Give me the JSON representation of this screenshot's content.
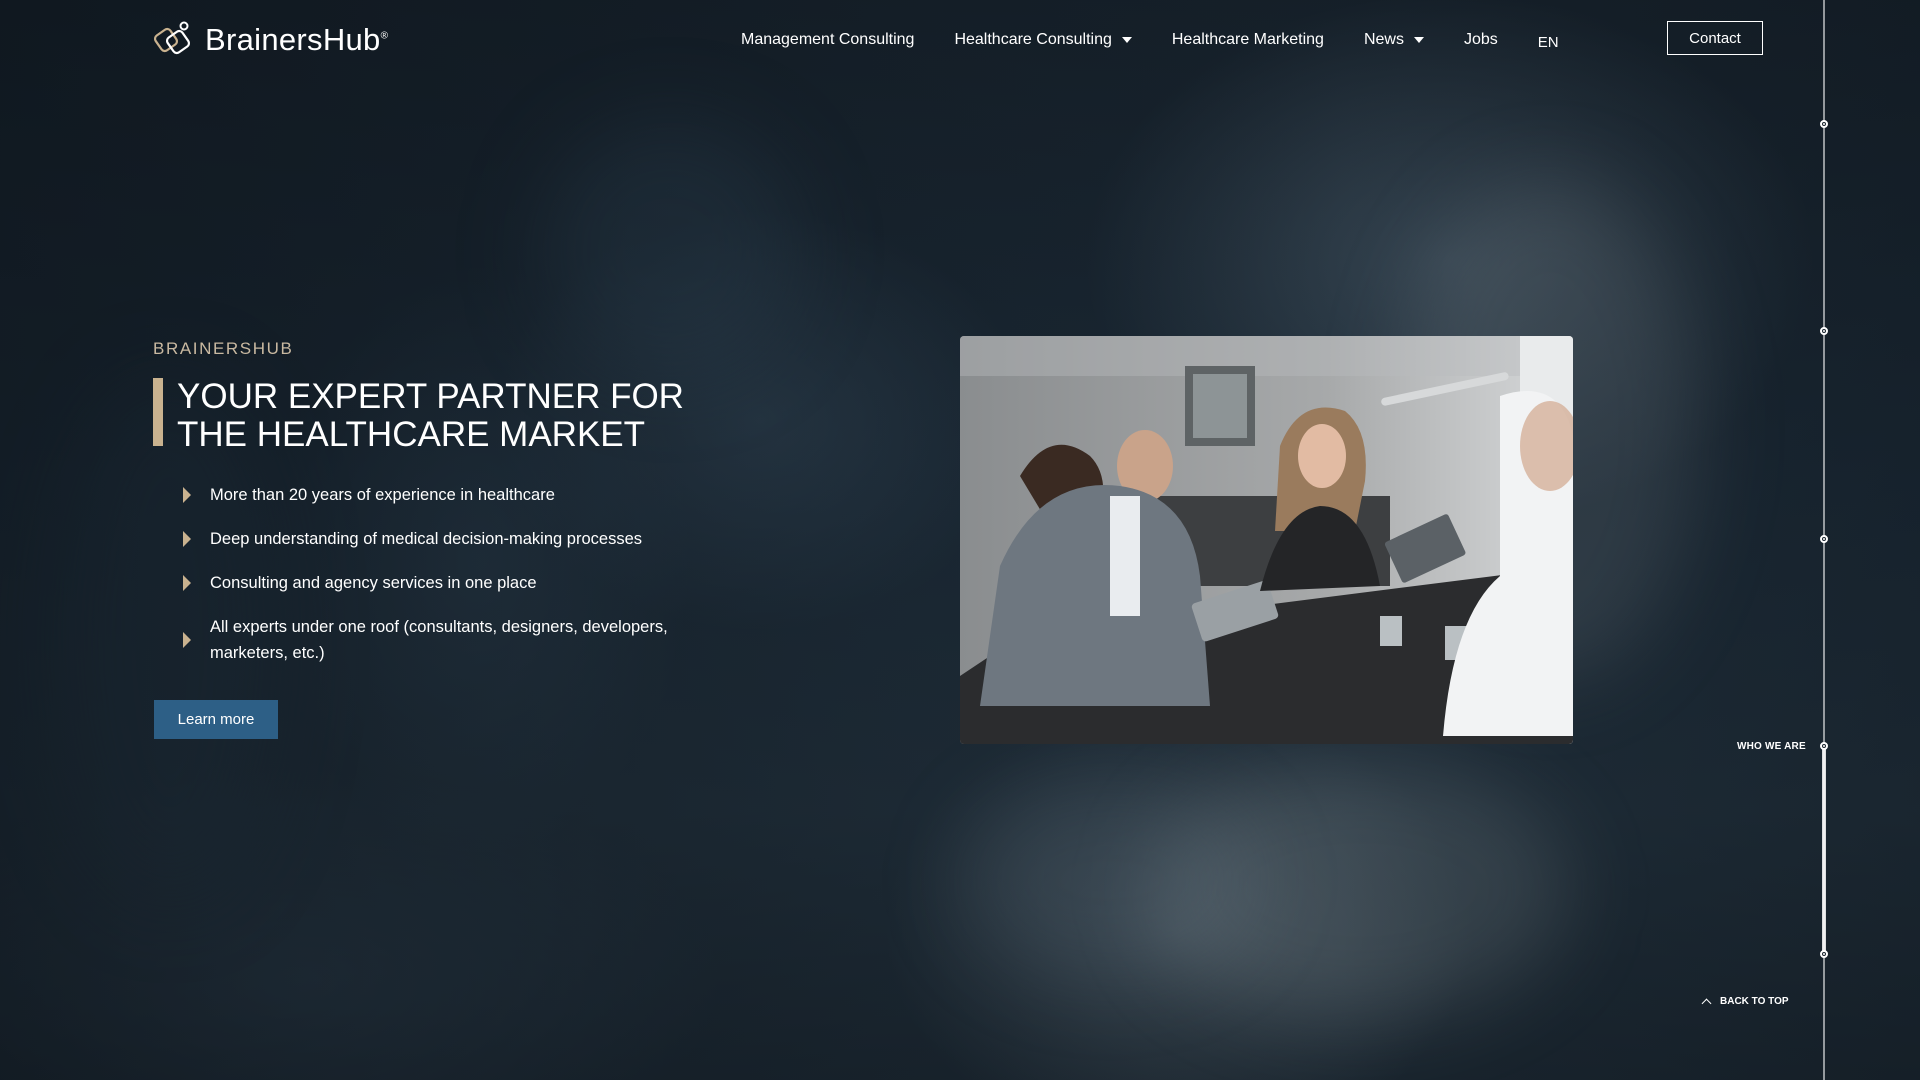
{
  "brand": {
    "name": "BrainersHub",
    "trademark": "®"
  },
  "nav": {
    "items": [
      {
        "label": "Management Consulting",
        "has_dropdown": false
      },
      {
        "label": "Healthcare Consulting",
        "has_dropdown": true
      },
      {
        "label": "Healthcare Marketing",
        "has_dropdown": false
      },
      {
        "label": "News",
        "has_dropdown": true
      },
      {
        "label": "Jobs",
        "has_dropdown": false
      }
    ],
    "language": "EN",
    "contact_label": "Contact"
  },
  "hero": {
    "eyebrow": "BRAINERSHUB",
    "headline": "YOUR EXPERT PARTNER FOR THE HEALTHCARE MARKET",
    "bullets": [
      "More than 20 years of experience in healthcare",
      "Deep understanding of medical decision-making processes",
      "Consulting and agency services in one place",
      "All experts under one roof (consultants, designers, developers, marketers, etc.)"
    ],
    "cta_label": "Learn more"
  },
  "side_nav": {
    "active_label": "WHO WE ARE",
    "back_to_top": "BACK TO TOP"
  },
  "colors": {
    "accent_gold": "#c9b28f",
    "eyebrow": "#c9b9a1",
    "button_blue": "#2d5f86",
    "background": "#16232f"
  }
}
